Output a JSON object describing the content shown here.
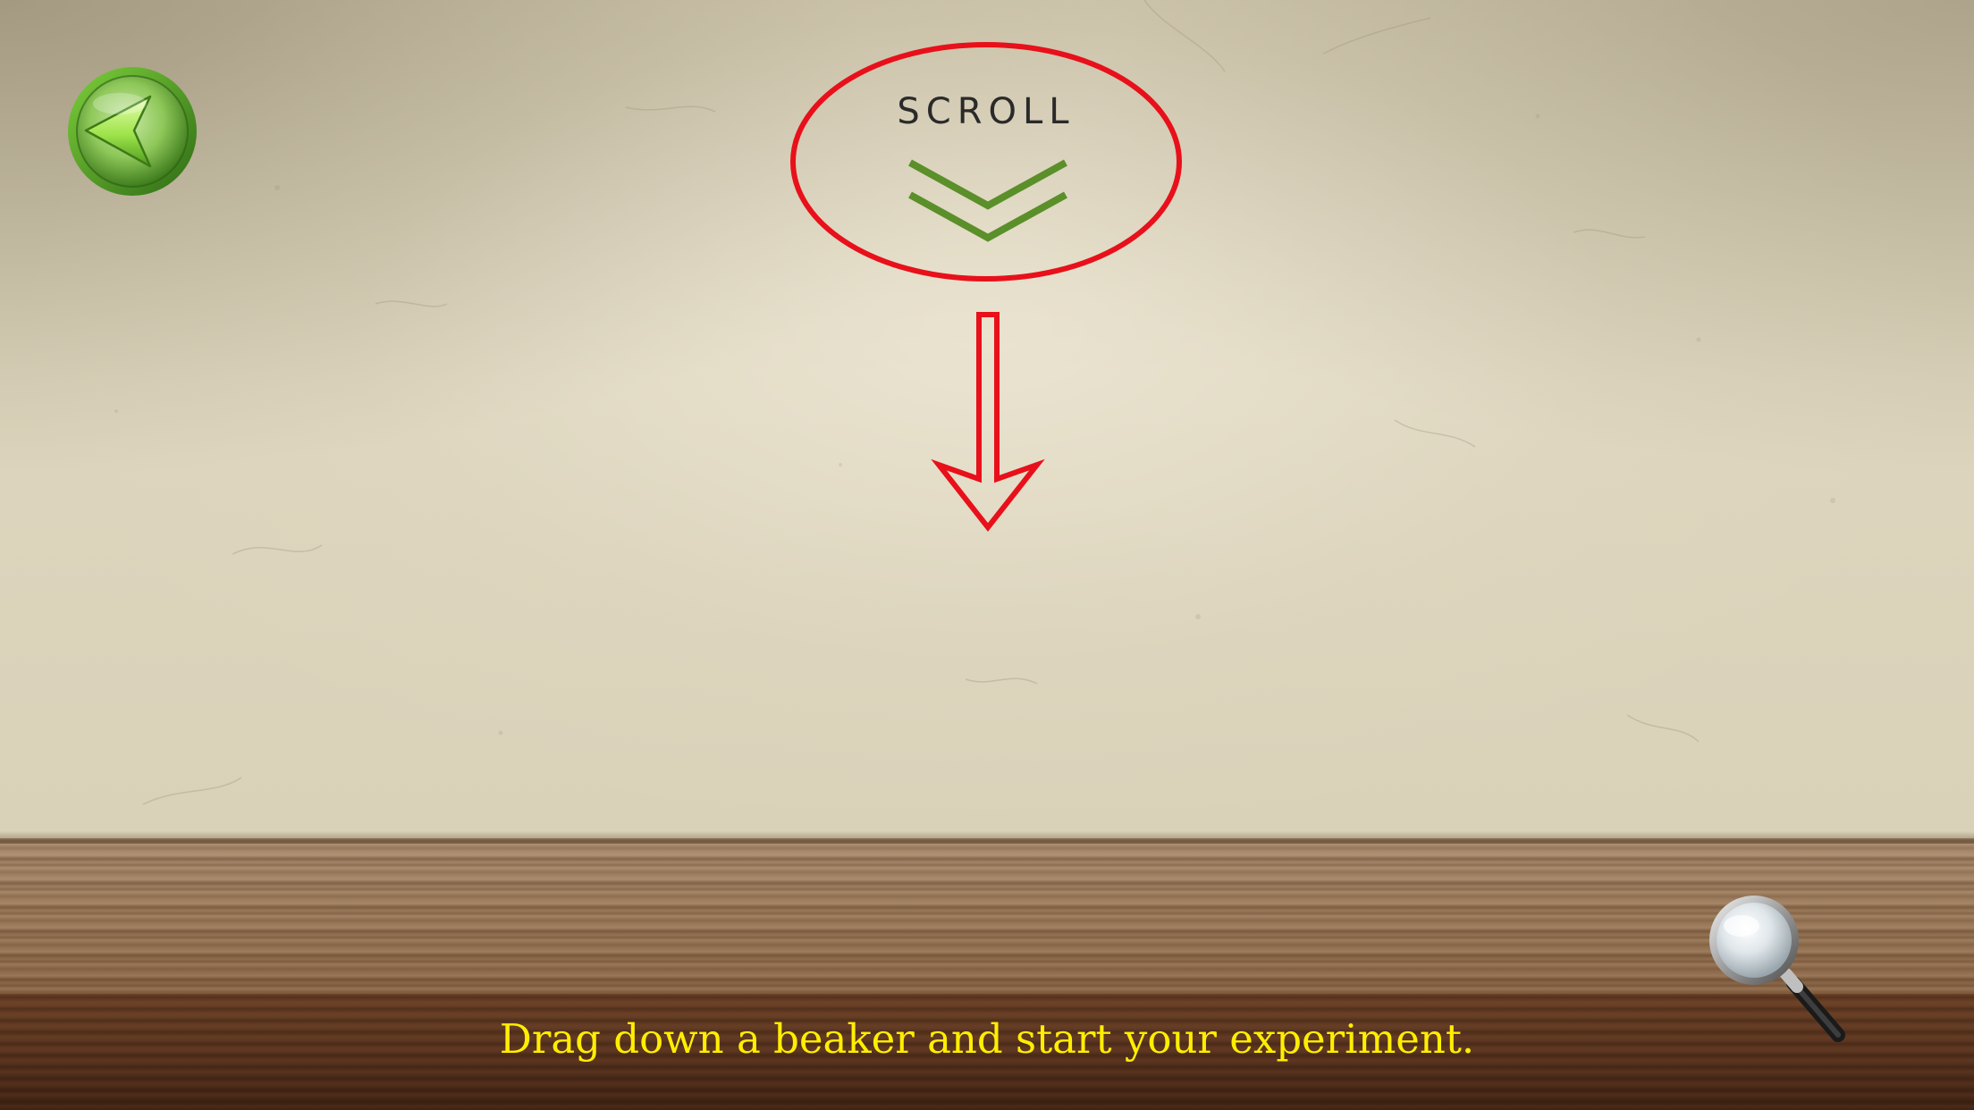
{
  "scroll_hint": {
    "label": "SCROLL",
    "icon": "double-chevron-down-icon",
    "chevron_color": "#5a8f2a",
    "circle_color": "#e8101a"
  },
  "arrow": {
    "icon": "down-arrow-icon",
    "color": "#e8101a"
  },
  "back_button": {
    "icon": "back-arrow-icon",
    "color": "#6cb52a"
  },
  "magnifier_button": {
    "icon": "magnifying-glass-icon"
  },
  "instruction": {
    "text": "Drag down a beaker and start your experiment.",
    "color": "#ffee00"
  }
}
